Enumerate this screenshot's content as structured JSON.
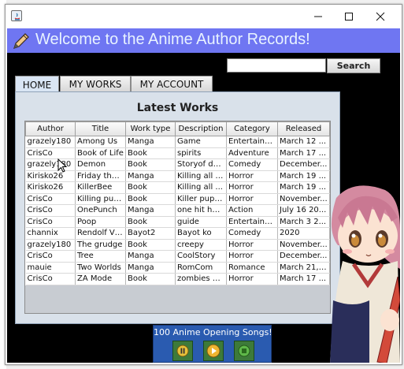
{
  "window": {
    "minimize_label": "minimize",
    "maximize_label": "maximize",
    "close_label": "close"
  },
  "header": {
    "title": "Welcome to the Anime Author Records!"
  },
  "search": {
    "value": "",
    "button_label": "Search"
  },
  "tabs": [
    {
      "label": "HOME",
      "active": true
    },
    {
      "label": "MY WORKS",
      "active": false
    },
    {
      "label": "MY ACCOUNT",
      "active": false
    }
  ],
  "latest": {
    "title": "Latest Works",
    "columns": [
      "Author",
      "Title",
      "Work type",
      "Description",
      "Category",
      "Released"
    ],
    "rows": [
      [
        "grazely180",
        "Among Us",
        "Manga",
        "Game",
        "Entertainm...",
        "March 12 ..."
      ],
      [
        "CrisCo",
        "Book of Life",
        "Book",
        "spirits",
        "Adventure",
        "March 17 ..."
      ],
      [
        "grazely180",
        "Demon",
        "Book",
        "Storyof de...",
        "Comedy",
        "December..."
      ],
      [
        "Kirisko26",
        "Friday the ...",
        "Manga",
        "Killing all t...",
        "Horror",
        "March 19 ..."
      ],
      [
        "Kirisko26",
        "KillerBee",
        "Book",
        "Killing all ...",
        "Horror",
        "March 19 ..."
      ],
      [
        "CrisCo",
        "Killing pup...",
        "Book",
        "Killer pupp...",
        "Horror",
        "November..."
      ],
      [
        "CrisCo",
        "OnePunch",
        "Manga",
        "one hit hero",
        "Action",
        "July 16 20..."
      ],
      [
        "CrisCo",
        "Poop",
        "Book",
        "guide",
        "Entertainm...",
        "March 3 2..."
      ],
      [
        "channix",
        "Rendolf Vi...",
        "Bayot2",
        "Bayot ko",
        "Comedy",
        "2020"
      ],
      [
        "grazely180",
        "The grudge",
        "Book",
        "creepy",
        "Horror",
        "November..."
      ],
      [
        "CrisCo",
        "Tree",
        "Manga",
        "CoolStory",
        "Horror",
        "December..."
      ],
      [
        "mauie",
        "Two Worlds",
        "Manga",
        "RomCom",
        "Romance",
        "March 21, ..."
      ],
      [
        "CrisCo",
        "ZA Mode",
        "Book",
        "zombies o...",
        "Horror",
        "March 17 ..."
      ]
    ]
  },
  "player": {
    "title": "100 Anime Opening Songs!",
    "buttons": [
      "pause",
      "play",
      "stop"
    ]
  },
  "colors": {
    "banner": "#6f76f2",
    "banner_text": "#e8f3ff",
    "player_bg": "#2a5bb0",
    "player_button": "#3d7a3a"
  }
}
